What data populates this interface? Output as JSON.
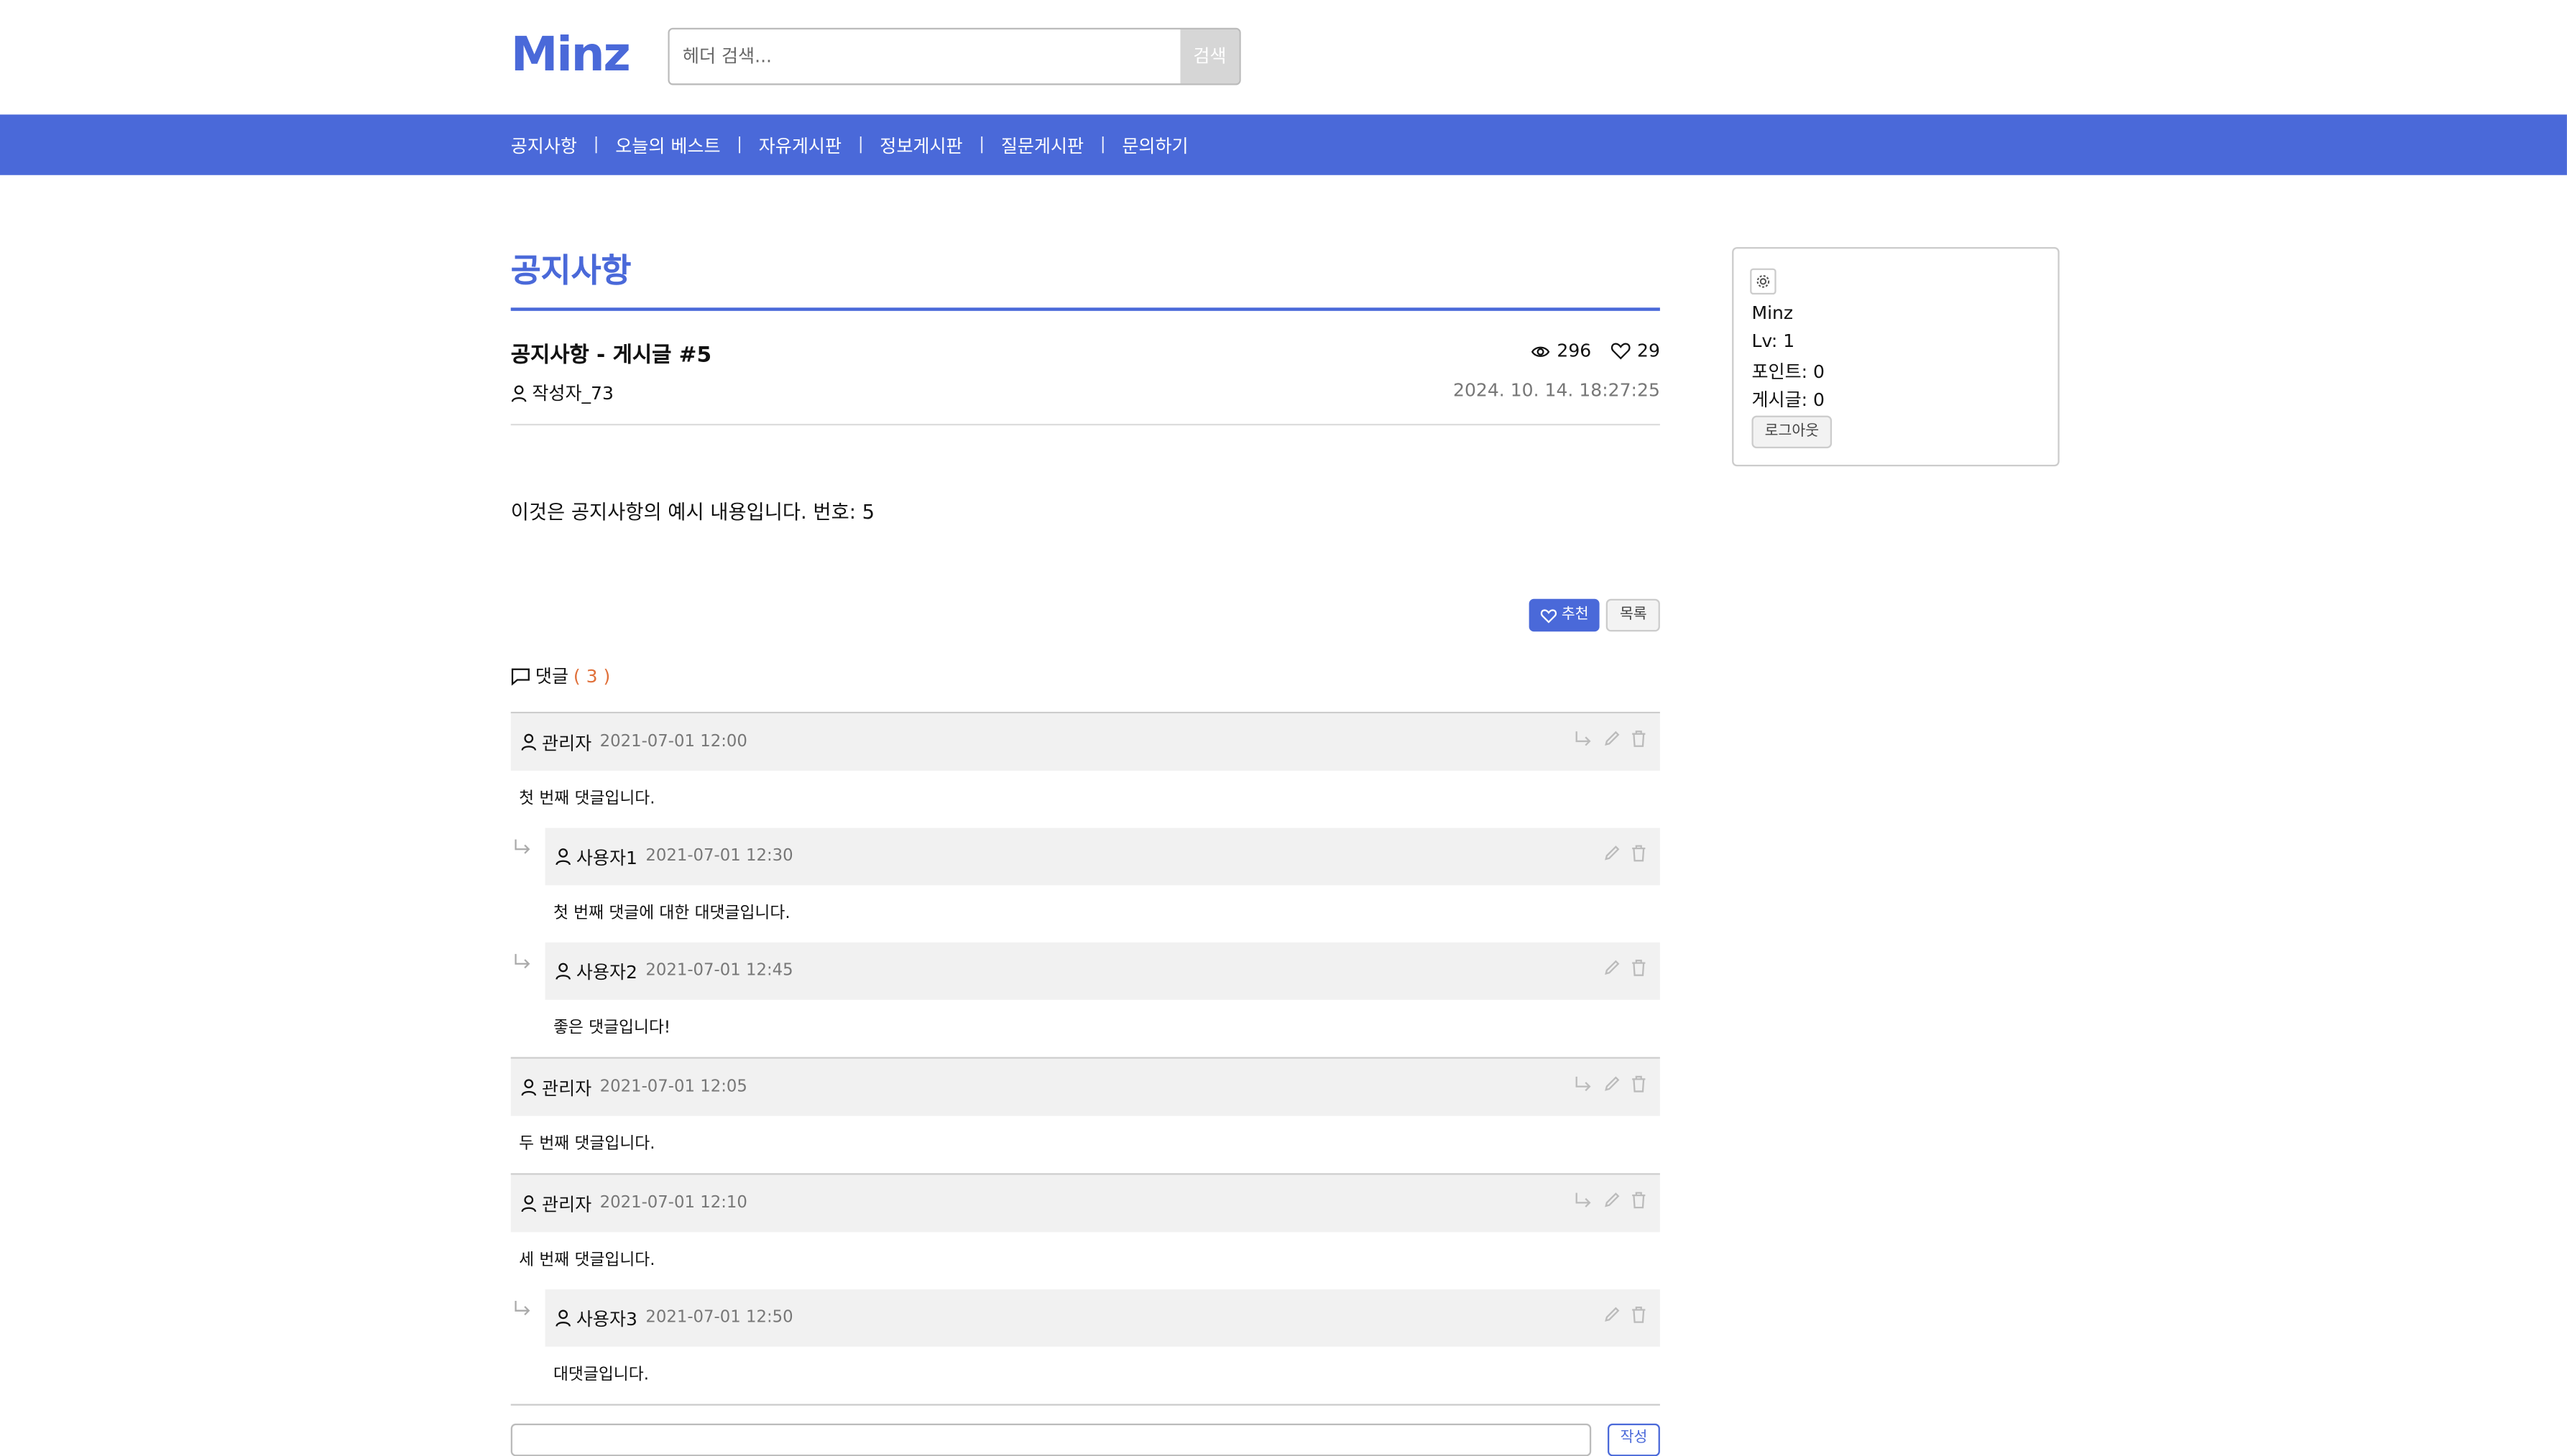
{
  "header": {
    "logo": "Minz",
    "search_placeholder": "헤더 검색...",
    "search_button": "검색"
  },
  "nav": [
    "공지사항",
    "오늘의 베스트",
    "자유게시판",
    "정보게시판",
    "질문게시판",
    "문의하기"
  ],
  "board": {
    "title": "공지사항"
  },
  "post": {
    "title": "공지사항 - 게시글 #5",
    "views": "296",
    "likes": "29",
    "author": "작성자_73",
    "date": "2024. 10. 14. 18:27:25",
    "content": "이것은 공지사항의 예시 내용입니다. 번호: 5",
    "recommend_label": "추천",
    "list_label": "목록"
  },
  "comments": {
    "label": "댓글",
    "count": "( 3 )",
    "items": [
      {
        "author": "관리자",
        "time": "2021-07-01 12:00",
        "text": "첫 번째 댓글입니다."
      },
      {
        "author": "사용자1",
        "time": "2021-07-01 12:30",
        "text": "첫 번째 댓글에 대한 대댓글입니다."
      },
      {
        "author": "사용자2",
        "time": "2021-07-01 12:45",
        "text": "좋은 댓글입니다!"
      },
      {
        "author": "관리자",
        "time": "2021-07-01 12:05",
        "text": "두 번째 댓글입니다."
      },
      {
        "author": "관리자",
        "time": "2021-07-01 12:10",
        "text": "세 번째 댓글입니다."
      },
      {
        "author": "사용자3",
        "time": "2021-07-01 12:50",
        "text": "대댓글입니다."
      }
    ],
    "write_button": "작성"
  },
  "sidebar": {
    "username": "Minz",
    "level": "Lv: 1",
    "points": "포인트: 0",
    "posts": "게시글: 0",
    "logout": "로그아웃"
  },
  "colors": {
    "accent": "#4a69d9",
    "count": "#e0703a"
  }
}
